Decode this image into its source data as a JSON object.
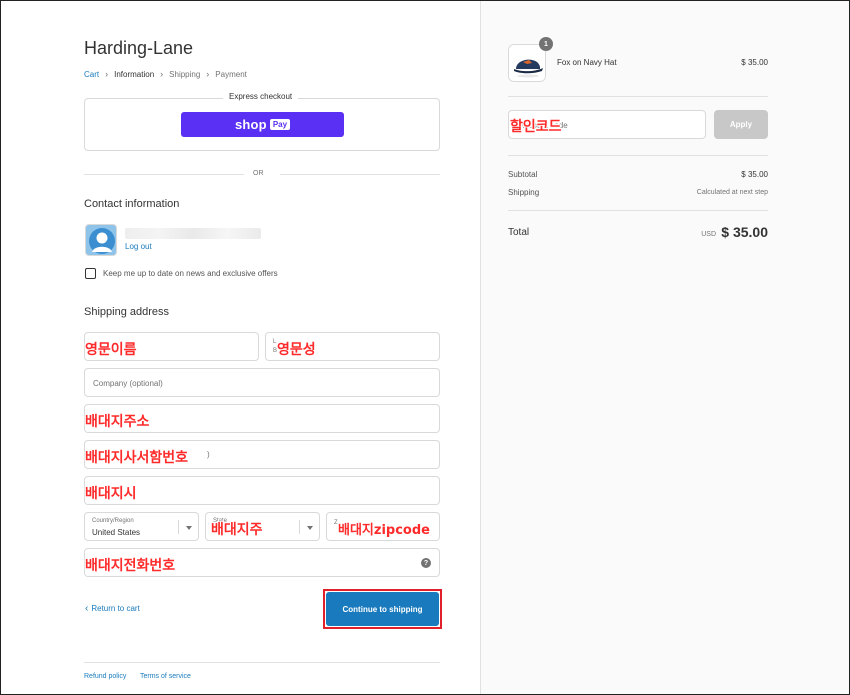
{
  "store": {
    "name": "Harding-Lane"
  },
  "breadcrumb": {
    "items": [
      "Cart",
      "Information",
      "Shipping",
      "Payment"
    ]
  },
  "express": {
    "title": "Express checkout",
    "shop_word": "shop",
    "pay_word": "Pay",
    "or_text": "OR"
  },
  "contact": {
    "title": "Contact information",
    "logout": "Log out",
    "newsletter_label": "Keep me up to date on news and exclusive offers"
  },
  "shipping": {
    "title": "Shipping address",
    "first_name_annot": "영문이름",
    "last_name_annot": "영문성",
    "last_name_hint": "L",
    "last_name_hint2": "B",
    "company_placeholder": "Company (optional)",
    "address_annot": "배대지주소",
    "apartment_annot": "배대지사서함번호",
    "apartment_hint": ")",
    "city_annot": "배대지시",
    "country_label": "Country/Region",
    "country_value": "United States",
    "state_label": "State",
    "state_annot": "배대지주",
    "zip_hint": "Z",
    "zip_annot": "배대지zipcode",
    "phone_annot": "배대지전화번호",
    "help_glyph": "?"
  },
  "actions": {
    "return_chevron": "‹",
    "return_label": "Return to cart",
    "continue_label": "Continue to shipping"
  },
  "footer": {
    "refund": "Refund policy",
    "terms": "Terms of service"
  },
  "summary": {
    "product": {
      "name": "Fox on Navy Hat",
      "price": "$ 35.00",
      "quantity": "1"
    },
    "discount": {
      "placeholder": "Discount code",
      "annot": "할인코드",
      "apply_label": "Apply"
    },
    "subtotal_label": "Subtotal",
    "subtotal_value": "$ 35.00",
    "shipping_label": "Shipping",
    "shipping_value": "Calculated at next step",
    "total_label": "Total",
    "currency": "USD",
    "total_value": "$ 35.00"
  },
  "colors": {
    "link": "#197bbd",
    "shop_pay": "#5a31f4",
    "annotation": "#ff2a2a",
    "highlight_box": "#e0202a"
  }
}
